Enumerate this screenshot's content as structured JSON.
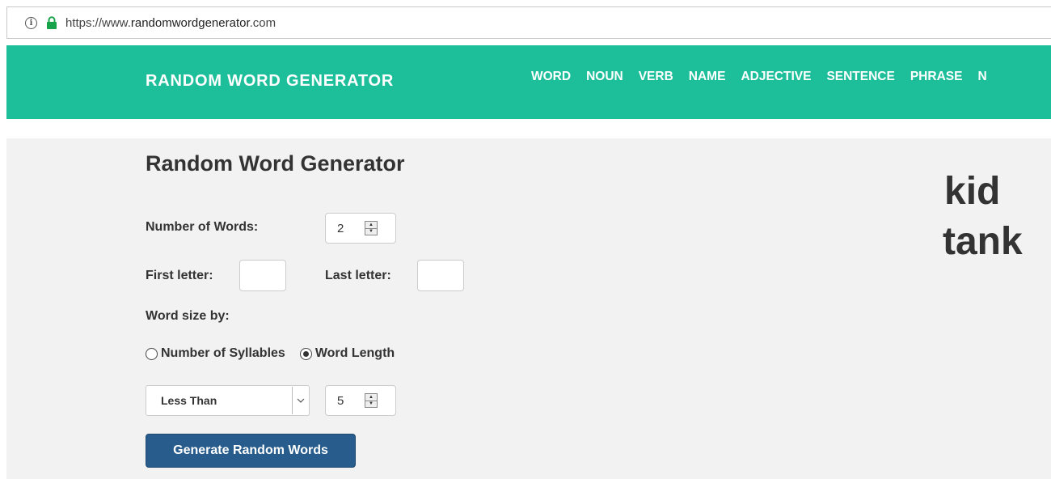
{
  "browser": {
    "url_prefix": "https://www.",
    "url_domain": "randomwordgenerator",
    "url_suffix": ".com"
  },
  "navbar": {
    "brand": "RANDOM WORD GENERATOR",
    "links": [
      "WORD",
      "NOUN",
      "VERB",
      "NAME",
      "ADJECTIVE",
      "SENTENCE",
      "PHRASE",
      "N"
    ],
    "background": "#1dbf9b"
  },
  "form": {
    "title": "Random Word Generator",
    "num_words_label": "Number of Words:",
    "num_words_value": "2",
    "first_letter_label": "First letter:",
    "first_letter_value": "",
    "last_letter_label": "Last letter:",
    "last_letter_value": "",
    "word_size_label": "Word size by:",
    "radio_syllables_label": "Number of Syllables",
    "radio_length_label": "Word Length",
    "selected_radio": "Word Length",
    "comparison_select": "Less Than",
    "size_value": "5",
    "generate_button": "Generate Random Words",
    "button_color": "#275c8c"
  },
  "results": {
    "words": [
      "kid",
      "tank"
    ]
  }
}
